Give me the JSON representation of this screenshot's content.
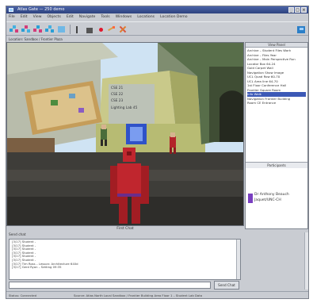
{
  "window": {
    "title": "Atlas Gate — 250 demo"
  },
  "menu": [
    "File",
    "Edit",
    "View",
    "Objects",
    "Edit",
    "Navigate",
    "Tools",
    "Windows",
    "Locations",
    "Location Demo"
  ],
  "address": {
    "text": "Location: Sandbox / Frontier Plaza"
  },
  "toolbar": {
    "icons": [
      "world-cube-icon",
      "world-cube-icon-2",
      "world-cube-icon-3",
      "world-cube-icon-4",
      "map-icon",
      "save-icon",
      "record-icon",
      "magic-wand-icon",
      "tools-icon"
    ]
  },
  "viewport": {
    "overlay_lines": [
      "CSE 21",
      "CSE 22",
      "CSE 23",
      "Lighting Lab 45"
    ],
    "caption": "First Chat"
  },
  "right_pane": {
    "title": "View Panel",
    "items": [
      {
        "label": "Archive – Student Files Work",
        "selected": false
      },
      {
        "label": "Archive – Files Year",
        "selected": false
      },
      {
        "label": "Archive – Main Perspective Run",
        "selected": false
      },
      {
        "label": "Locator Box 64-24",
        "selected": false
      },
      {
        "label": "Gold Carpet Wall",
        "selected": false
      },
      {
        "label": "Navigation Show Image",
        "selected": false
      },
      {
        "label": "UCL Quad Row 60-70",
        "selected": false
      },
      {
        "label": "UCL Area line 64-70",
        "selected": false
      },
      {
        "label": "1st Floor Conference Hall",
        "selected": false
      },
      {
        "label": "Frontier Square Room",
        "selected": false
      },
      {
        "label": "Info Walk",
        "selected": true
      },
      {
        "label": "Navigation Frontier Building",
        "selected": false
      },
      {
        "label": "Room CE Entrance",
        "selected": false
      }
    ],
    "participants_title": "Participants",
    "participant": {
      "name_line1": "Dr Anthony Beauch",
      "name_line2": "Jaquet/UNC-CH",
      "color": "#7a3fc0"
    }
  },
  "chat": {
    "label": "Send chat",
    "lines": [
      "[3/17] Student - ",
      "[3/17] Student - ",
      "[3/17] Student - ",
      "[3/17] Student - ",
      "[3/17] Student - ",
      "[3/17] Student - ",
      "[3/17] Tim Ross – Lesson: Architecture 640d",
      "[3/17] Gerd Ryon – Setting 09:35"
    ],
    "input_value": "",
    "send_label": "Send Chat"
  },
  "status": {
    "left": "Status: Connected",
    "right": "Source: Atlas North Local Sandbox / Frontier Building Area Floor 1 – Student Lab Data"
  },
  "colors": {
    "title_bar": "#2e437f",
    "selection": "#3c59b6",
    "avatar": "#c0262e"
  }
}
